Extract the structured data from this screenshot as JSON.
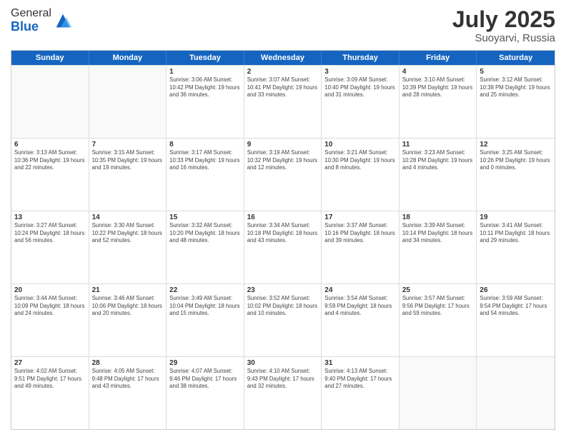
{
  "header": {
    "logo_general": "General",
    "logo_blue": "Blue",
    "title": "July 2025",
    "location": "Suoyarvi, Russia"
  },
  "days_of_week": [
    "Sunday",
    "Monday",
    "Tuesday",
    "Wednesday",
    "Thursday",
    "Friday",
    "Saturday"
  ],
  "weeks": [
    [
      {
        "day": "",
        "info": ""
      },
      {
        "day": "",
        "info": ""
      },
      {
        "day": "1",
        "info": "Sunrise: 3:06 AM\nSunset: 10:42 PM\nDaylight: 19 hours and 36 minutes."
      },
      {
        "day": "2",
        "info": "Sunrise: 3:07 AM\nSunset: 10:41 PM\nDaylight: 19 hours and 33 minutes."
      },
      {
        "day": "3",
        "info": "Sunrise: 3:09 AM\nSunset: 10:40 PM\nDaylight: 19 hours and 31 minutes."
      },
      {
        "day": "4",
        "info": "Sunrise: 3:10 AM\nSunset: 10:39 PM\nDaylight: 19 hours and 28 minutes."
      },
      {
        "day": "5",
        "info": "Sunrise: 3:12 AM\nSunset: 10:38 PM\nDaylight: 19 hours and 25 minutes."
      }
    ],
    [
      {
        "day": "6",
        "info": "Sunrise: 3:13 AM\nSunset: 10:36 PM\nDaylight: 19 hours and 22 minutes."
      },
      {
        "day": "7",
        "info": "Sunrise: 3:15 AM\nSunset: 10:35 PM\nDaylight: 19 hours and 19 minutes."
      },
      {
        "day": "8",
        "info": "Sunrise: 3:17 AM\nSunset: 10:33 PM\nDaylight: 19 hours and 16 minutes."
      },
      {
        "day": "9",
        "info": "Sunrise: 3:19 AM\nSunset: 10:32 PM\nDaylight: 19 hours and 12 minutes."
      },
      {
        "day": "10",
        "info": "Sunrise: 3:21 AM\nSunset: 10:30 PM\nDaylight: 19 hours and 8 minutes."
      },
      {
        "day": "11",
        "info": "Sunrise: 3:23 AM\nSunset: 10:28 PM\nDaylight: 19 hours and 4 minutes."
      },
      {
        "day": "12",
        "info": "Sunrise: 3:25 AM\nSunset: 10:26 PM\nDaylight: 19 hours and 0 minutes."
      }
    ],
    [
      {
        "day": "13",
        "info": "Sunrise: 3:27 AM\nSunset: 10:24 PM\nDaylight: 18 hours and 56 minutes."
      },
      {
        "day": "14",
        "info": "Sunrise: 3:30 AM\nSunset: 10:22 PM\nDaylight: 18 hours and 52 minutes."
      },
      {
        "day": "15",
        "info": "Sunrise: 3:32 AM\nSunset: 10:20 PM\nDaylight: 18 hours and 48 minutes."
      },
      {
        "day": "16",
        "info": "Sunrise: 3:34 AM\nSunset: 10:18 PM\nDaylight: 18 hours and 43 minutes."
      },
      {
        "day": "17",
        "info": "Sunrise: 3:37 AM\nSunset: 10:16 PM\nDaylight: 18 hours and 39 minutes."
      },
      {
        "day": "18",
        "info": "Sunrise: 3:39 AM\nSunset: 10:14 PM\nDaylight: 18 hours and 34 minutes."
      },
      {
        "day": "19",
        "info": "Sunrise: 3:41 AM\nSunset: 10:11 PM\nDaylight: 18 hours and 29 minutes."
      }
    ],
    [
      {
        "day": "20",
        "info": "Sunrise: 3:44 AM\nSunset: 10:09 PM\nDaylight: 18 hours and 24 minutes."
      },
      {
        "day": "21",
        "info": "Sunrise: 3:46 AM\nSunset: 10:06 PM\nDaylight: 18 hours and 20 minutes."
      },
      {
        "day": "22",
        "info": "Sunrise: 3:49 AM\nSunset: 10:04 PM\nDaylight: 18 hours and 15 minutes."
      },
      {
        "day": "23",
        "info": "Sunrise: 3:52 AM\nSunset: 10:02 PM\nDaylight: 18 hours and 10 minutes."
      },
      {
        "day": "24",
        "info": "Sunrise: 3:54 AM\nSunset: 9:59 PM\nDaylight: 18 hours and 4 minutes."
      },
      {
        "day": "25",
        "info": "Sunrise: 3:57 AM\nSunset: 9:56 PM\nDaylight: 17 hours and 59 minutes."
      },
      {
        "day": "26",
        "info": "Sunrise: 3:59 AM\nSunset: 9:54 PM\nDaylight: 17 hours and 54 minutes."
      }
    ],
    [
      {
        "day": "27",
        "info": "Sunrise: 4:02 AM\nSunset: 9:51 PM\nDaylight: 17 hours and 49 minutes."
      },
      {
        "day": "28",
        "info": "Sunrise: 4:05 AM\nSunset: 9:48 PM\nDaylight: 17 hours and 43 minutes."
      },
      {
        "day": "29",
        "info": "Sunrise: 4:07 AM\nSunset: 9:46 PM\nDaylight: 17 hours and 38 minutes."
      },
      {
        "day": "30",
        "info": "Sunrise: 4:10 AM\nSunset: 9:43 PM\nDaylight: 17 hours and 32 minutes."
      },
      {
        "day": "31",
        "info": "Sunrise: 4:13 AM\nSunset: 9:40 PM\nDaylight: 17 hours and 27 minutes."
      },
      {
        "day": "",
        "info": ""
      },
      {
        "day": "",
        "info": ""
      }
    ]
  ]
}
